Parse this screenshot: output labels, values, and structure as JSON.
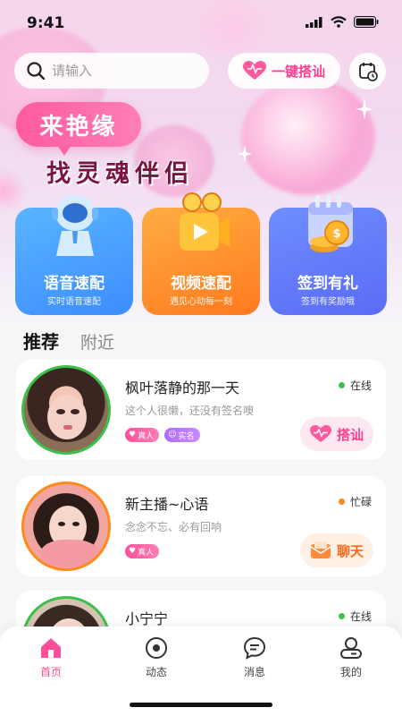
{
  "status_bar": {
    "time": "9:41"
  },
  "search": {
    "placeholder": "请输入"
  },
  "header": {
    "quick_greet_label": "一键搭讪"
  },
  "banner": {
    "bubble_text": "来艳缘",
    "slogan": "找灵魂伴侣"
  },
  "feature_cards": [
    {
      "title": "语音速配",
      "subtitle": "实时语音速配",
      "icon": "headset-robot-icon"
    },
    {
      "title": "视频速配",
      "subtitle": "遇见心动每一刻",
      "icon": "video-camera-icon"
    },
    {
      "title": "签到有礼",
      "subtitle": "签到有奖励哦",
      "icon": "calendar-coins-icon"
    }
  ],
  "tabs": [
    {
      "label": "推荐"
    },
    {
      "label": "附近"
    }
  ],
  "users": [
    {
      "name": "枫叶落静的那一天",
      "signature": "这个人很懒，还没有签名噢",
      "status": "在线",
      "status_color": "#3cc04a",
      "badges": [
        "真人",
        "实名"
      ],
      "action": "搭讪",
      "avatar_ring": "#3cc04a"
    },
    {
      "name": "新主播~心语",
      "signature": "念念不忘、必有回响",
      "status": "忙碌",
      "status_color": "#ff8a1a",
      "badges": [
        "真人"
      ],
      "action": "聊天",
      "avatar_ring": "#ff8a1a"
    },
    {
      "name": "小宁宁",
      "signature": "",
      "status": "在线",
      "status_color": "#3cc04a",
      "badges": [],
      "action": "",
      "avatar_ring": "#3cc04a"
    }
  ],
  "tabbar": [
    {
      "label": "首页",
      "icon": "home-icon",
      "active": true
    },
    {
      "label": "动态",
      "icon": "moments-icon",
      "active": false
    },
    {
      "label": "消息",
      "icon": "message-icon",
      "active": false
    },
    {
      "label": "我的",
      "icon": "profile-icon",
      "active": false
    }
  ],
  "colors": {
    "accent": "#ff3f8f",
    "tab_active": "#ff4f9a"
  }
}
